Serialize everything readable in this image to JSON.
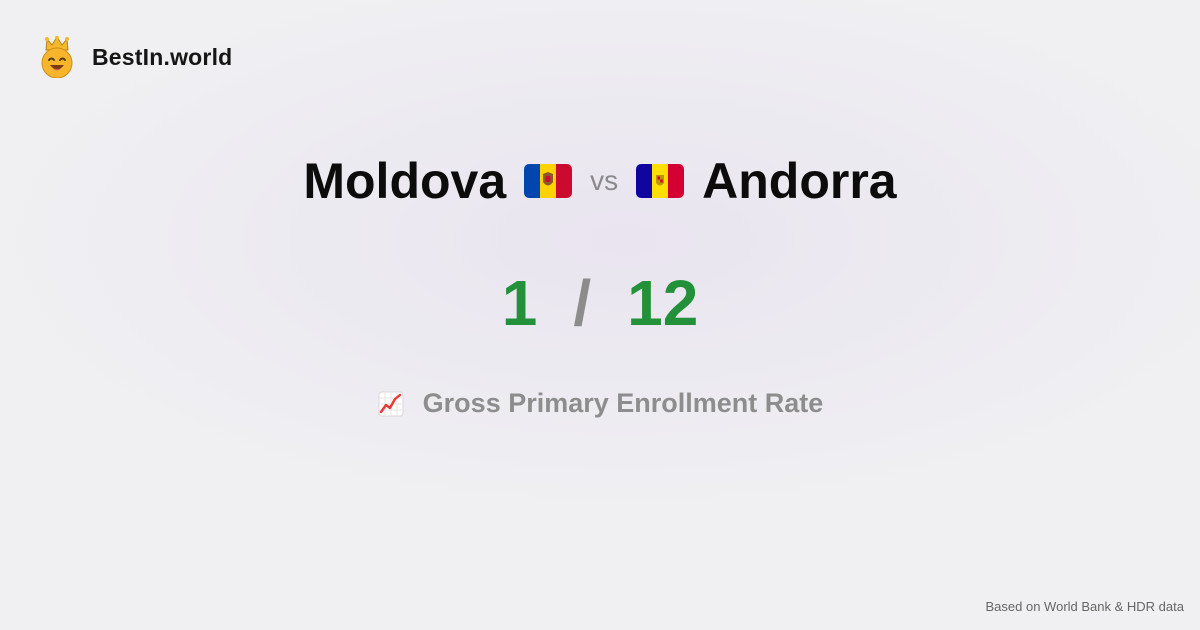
{
  "brand": {
    "name": "BestIn.world",
    "logo_icon": "crowned-smiley-icon"
  },
  "comparison": {
    "left_country": "Moldova",
    "left_flag": "moldova-flag-icon",
    "vs_label": "vs",
    "right_country": "Andorra",
    "right_flag": "andorra-flag-icon"
  },
  "scores": {
    "left_rank": "1",
    "separator": "/",
    "right_rank": "12",
    "rank_color": "#23913a",
    "separator_color": "#8c8c8c"
  },
  "metric": {
    "icon": "chart-increasing-icon",
    "label": "Gross Primary Enrollment Rate"
  },
  "footer": {
    "source_note": "Based on World Bank & HDR data"
  }
}
